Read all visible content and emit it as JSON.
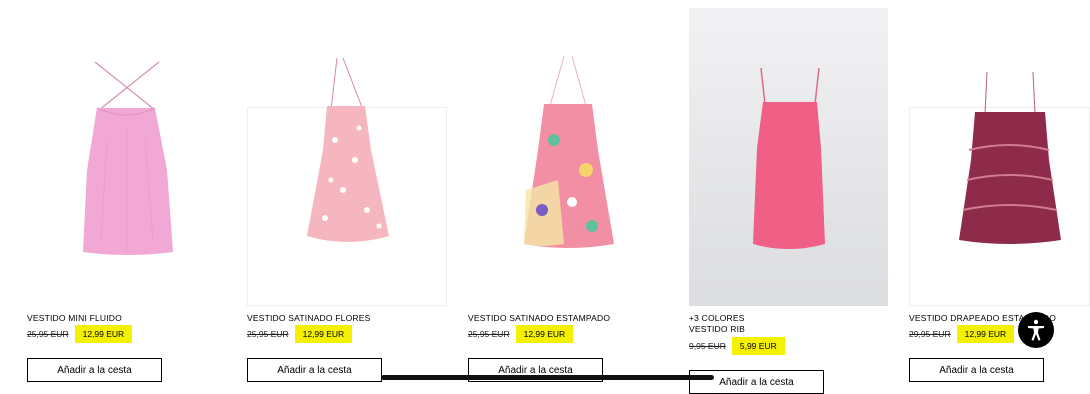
{
  "products": [
    {
      "name_lines": [
        "VESTIDO MINI FLUIDO"
      ],
      "old_price": "25,95 EUR",
      "sale_price": "12,99 EUR",
      "button": "Añadir a la cesta",
      "color": "#f3a9d3"
    },
    {
      "name_lines": [
        "VESTIDO SATINADO FLORES"
      ],
      "old_price": "25,95 EUR",
      "sale_price": "12,99 EUR",
      "button": "Añadir a la cesta",
      "color": "#f5b6bf"
    },
    {
      "name_lines": [
        "VESTIDO SATINADO ESTAMPADO"
      ],
      "old_price": "25,95 EUR",
      "sale_price": "12,99 EUR",
      "button": "Añadir a la cesta",
      "color": "#f28fa4"
    },
    {
      "name_lines": [
        "+3 COLORES",
        "VESTIDO RIB"
      ],
      "old_price": "9,95 EUR",
      "sale_price": "5,99 EUR",
      "button": "Añadir a la cesta",
      "color": "#ef5f86"
    },
    {
      "name_lines": [
        "VESTIDO DRAPEADO ESTAMPADO"
      ],
      "old_price": "29,95 EUR",
      "sale_price": "12,99 EUR",
      "button": "Añadir a la cesta",
      "color": "#8e2b4a"
    }
  ],
  "accessibility_icon": "accessibility-icon",
  "sale_highlight_color": "#f5f000"
}
